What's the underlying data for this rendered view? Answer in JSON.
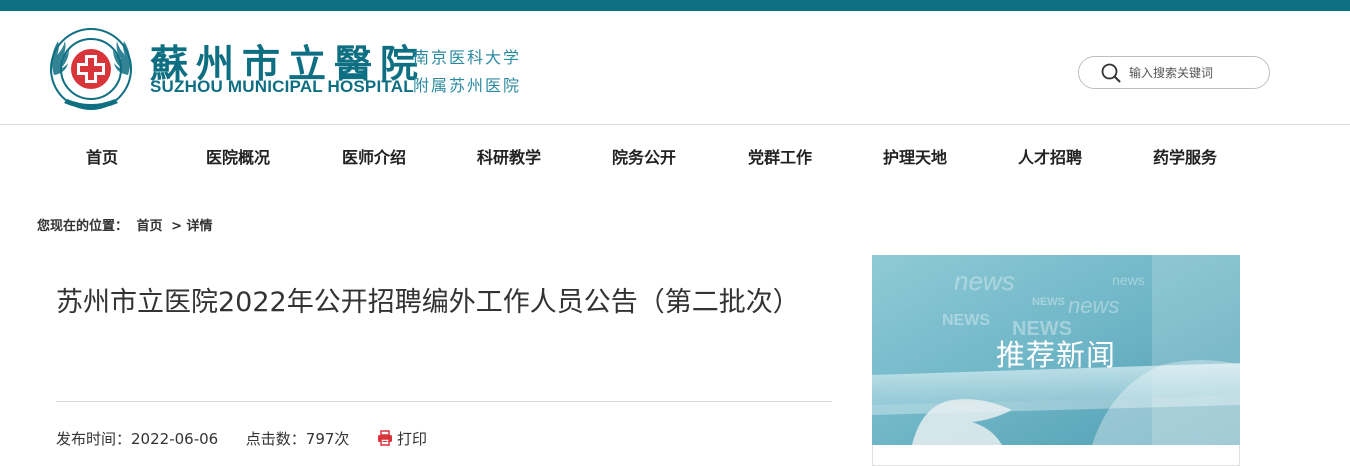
{
  "brand": {
    "name_cn": "蘇州市立醫院",
    "name_en": "SUZHOU MUNICIPAL HOSPITAL",
    "affiliation_line1": "南京医科大学",
    "affiliation_line2": "附属苏州医院",
    "color": "#0e6f83"
  },
  "search": {
    "placeholder": "输入搜索关键词",
    "icon": "search-icon"
  },
  "nav": [
    {
      "label": "首页"
    },
    {
      "label": "医院概况"
    },
    {
      "label": "医师介绍"
    },
    {
      "label": "科研教学"
    },
    {
      "label": "院务公开"
    },
    {
      "label": "党群工作"
    },
    {
      "label": "护理天地"
    },
    {
      "label": "人才招聘"
    },
    {
      "label": "药学服务"
    }
  ],
  "breadcrumb": {
    "prefix": "您现在的位置：",
    "home": "首页",
    "current": "> 详情"
  },
  "article": {
    "title": "苏州市立医院2022年公开招聘编外工作人员公告（第二批次）",
    "date_label": "发布时间：",
    "date": "2022-06-06",
    "views_label": "点击数：",
    "views": "797次",
    "print_label": "打印",
    "print_icon": "printer-icon",
    "print_icon_color": "#d9343a"
  },
  "sidebar": {
    "banner_title": "推荐新闻"
  }
}
